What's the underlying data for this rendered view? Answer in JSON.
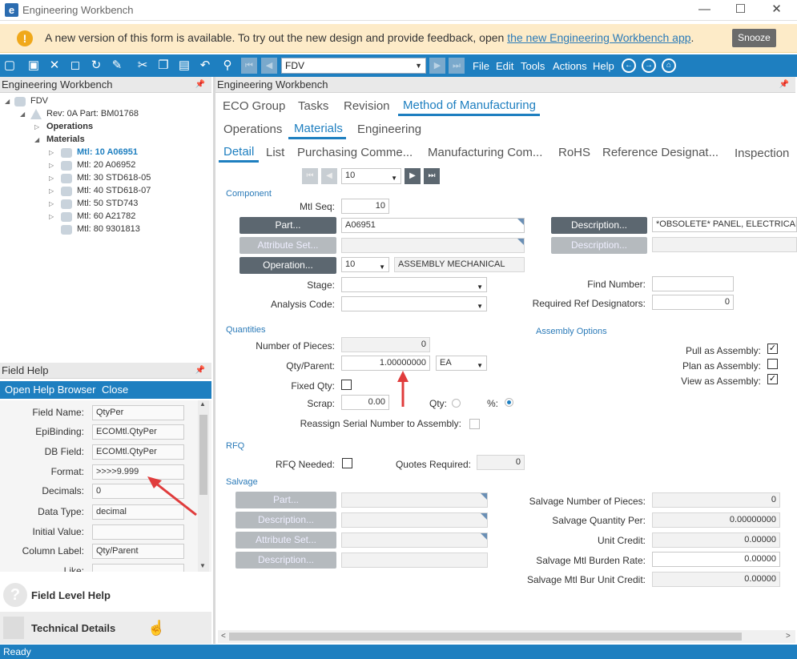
{
  "window": {
    "title": "Engineering Workbench",
    "minimize": "—",
    "maximize": "☐",
    "close": "✕"
  },
  "banner": {
    "text": "A new version of this form is available. To try out the new design and provide feedback, open ",
    "link": "the new Engineering Workbench app",
    "suffix": ".",
    "snooze": "Snooze"
  },
  "toolbar": {
    "combo_value": "FDV",
    "menus": [
      "File",
      "Edit",
      "Tools",
      "Actions",
      "Help"
    ]
  },
  "left_pane": {
    "title": "Engineering Workbench",
    "tree": {
      "root": "FDV",
      "rev": "Rev: 0A Part: BM01768",
      "operations": "Operations",
      "materials": "Materials",
      "items": [
        "Mtl: 10 A06951",
        "Mtl: 20 A06952",
        "Mtl: 30 STD618-05",
        "Mtl: 40 STD618-07",
        "Mtl: 50 STD743",
        "Mtl: 60 A21782",
        "Mtl: 80 9301813"
      ]
    }
  },
  "field_help": {
    "title": "Field Help",
    "open_browser": "Open Help Browser",
    "close": "Close",
    "rows": [
      {
        "label": "Field Name:",
        "value": "QtyPer"
      },
      {
        "label": "EpiBinding:",
        "value": "ECOMtl.QtyPer"
      },
      {
        "label": "DB Field:",
        "value": "ECOMtl.QtyPer"
      },
      {
        "label": "Format:",
        "value": ">>>>9.999"
      },
      {
        "label": "Decimals:",
        "value": "0"
      },
      {
        "label": "Data Type:",
        "value": "decimal"
      },
      {
        "label": "Initial Value:",
        "value": ""
      },
      {
        "label": "Column Label:",
        "value": "Qty/Parent"
      },
      {
        "label": "Like:",
        "value": ""
      }
    ],
    "nav": {
      "field_level_help": "Field Level Help",
      "technical_details": "Technical Details"
    }
  },
  "main": {
    "title": "Engineering Workbench",
    "tabs1": [
      "ECO Group",
      "Tasks",
      "Revision",
      "Method of Manufacturing"
    ],
    "tabs2": [
      "Operations",
      "Materials",
      "Engineering"
    ],
    "tabs3": [
      "Detail",
      "List",
      "Purchasing Comme...",
      "Manufacturing Com...",
      "RoHS",
      "Reference Designat...",
      "Inspection"
    ],
    "record_nav": {
      "value": "10"
    },
    "component": {
      "section": "Component",
      "mtl_seq_label": "Mtl Seq:",
      "mtl_seq": "10",
      "part_btn": "Part...",
      "part": "A06951",
      "attr_set_btn": "Attribute Set...",
      "operation_btn": "Operation...",
      "operation": "10",
      "operation_desc": "ASSEMBLY MECHANICAL",
      "stage_label": "Stage:",
      "analysis_label": "Analysis Code:",
      "desc_btn": "Description...",
      "desc": "*OBSOLETE* PANEL, ELECTRICAL B",
      "desc2_btn": "Description...",
      "find_label": "Find Number:",
      "find": "",
      "refdes_label": "Required Ref Designators:",
      "refdes": "0"
    },
    "quantities": {
      "section": "Quantities",
      "pieces_label": "Number of Pieces:",
      "pieces": "0",
      "qty_label": "Qty/Parent:",
      "qty": "1.00000000",
      "uom": "EA",
      "fixed_label": "Fixed Qty:",
      "scrap_label": "Scrap:",
      "scrap": "0.00",
      "qty_radio": "Qty:",
      "pct_radio": "%:",
      "reassign_label": "Reassign Serial Number to Assembly:"
    },
    "assembly": {
      "section": "Assembly Options",
      "pull": "Pull as Assembly:",
      "plan": "Plan as Assembly:",
      "view": "View as Assembly:",
      "pull_checked": true,
      "plan_checked": false,
      "view_checked": true
    },
    "rfq": {
      "section": "RFQ",
      "needed_label": "RFQ Needed:",
      "quotes_label": "Quotes Required:",
      "quotes": "0"
    },
    "salvage": {
      "section": "Salvage",
      "part_btn": "Part...",
      "desc_btn": "Description...",
      "attr_btn": "Attribute Set...",
      "desc2_btn": "Description...",
      "pieces_label": "Salvage Number of Pieces:",
      "pieces": "0",
      "qty_per_label": "Salvage Quantity Per:",
      "qty_per": "0.00000000",
      "unit_credit_label": "Unit Credit:",
      "unit_credit": "0.00000",
      "burden_label": "Salvage Mtl Burden Rate:",
      "burden": "0.00000",
      "bur_unit_label": "Salvage Mtl Bur Unit Credit:",
      "bur_unit": "0.00000"
    }
  },
  "status": {
    "text": "Ready"
  },
  "colors": {
    "accent": "#1e7fc0",
    "banner": "#fdebc8",
    "annotation_arrow": "#e03c3c"
  }
}
